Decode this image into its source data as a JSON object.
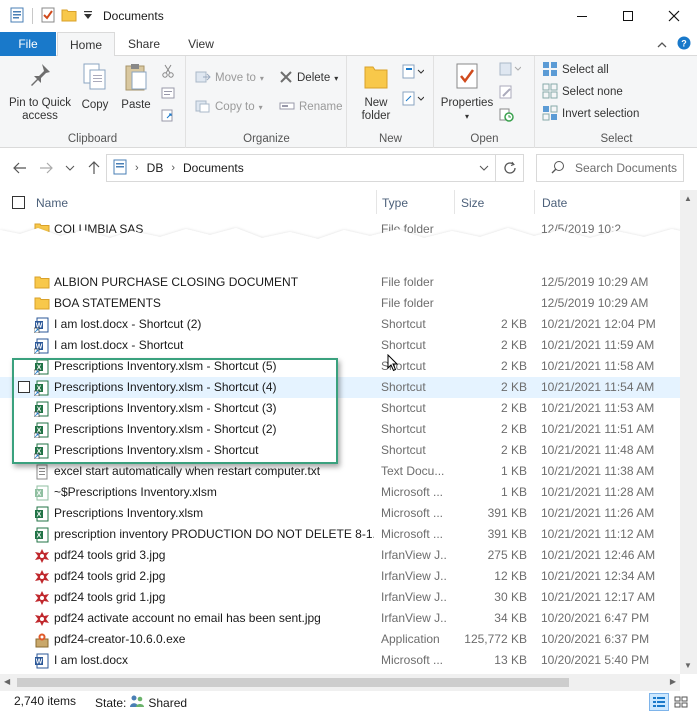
{
  "window": {
    "title": "Documents",
    "icons": [
      "properties-icon",
      "check-icon",
      "folder-icon",
      "dropdown-icon"
    ]
  },
  "ribbon_tabs": {
    "file": "File",
    "home": "Home",
    "share": "Share",
    "view": "View"
  },
  "ribbon": {
    "clipboard": {
      "label": "Clipboard",
      "pin": "Pin to Quick access",
      "pin_l1": "Pin to Quick",
      "pin_l2": "access",
      "copy": "Copy",
      "paste": "Paste"
    },
    "organize": {
      "label": "Organize",
      "move_to": "Move to",
      "copy_to": "Copy to",
      "delete": "Delete",
      "rename": "Rename"
    },
    "new": {
      "label": "New",
      "new_folder_l1": "New",
      "new_folder_l2": "folder"
    },
    "open": {
      "label": "Open",
      "properties": "Properties"
    },
    "select": {
      "label": "Select",
      "select_all": "Select all",
      "select_none": "Select none",
      "invert": "Invert selection"
    }
  },
  "address": {
    "crumbs": [
      "DB",
      "Documents"
    ],
    "search_placeholder": "Search Documents"
  },
  "columns": {
    "name": "Name",
    "type": "Type",
    "size": "Size",
    "date": "Date"
  },
  "partial_rows": {
    "top_name": "COLUMBIA SAS",
    "top_type": "File folder",
    "top_date": "12/5/2019 10:2",
    "second_name": "ALBION PURCHASE CLOSING DOCUMENT",
    "second_type": "File folder",
    "second_date": "12/5/2019 10:29 AM"
  },
  "files": [
    {
      "name": "BOA STATEMENTS",
      "type": "File folder",
      "size": "",
      "date": "12/5/2019 10:29 AM",
      "icon": "folder-icon"
    },
    {
      "name": "I am lost.docx - Shortcut (2)",
      "type": "Shortcut",
      "size": "2 KB",
      "date": "10/21/2021 12:04 PM",
      "icon": "word-shortcut-icon"
    },
    {
      "name": "I am lost.docx - Shortcut",
      "type": "Shortcut",
      "size": "2 KB",
      "date": "10/21/2021 11:59 AM",
      "icon": "word-shortcut-icon"
    },
    {
      "name": "Prescriptions Inventory.xlsm - Shortcut (5)",
      "type": "Shortcut",
      "size": "2 KB",
      "date": "10/21/2021 11:58 AM",
      "icon": "excel-shortcut-icon"
    },
    {
      "name": "Prescriptions Inventory.xlsm - Shortcut (4)",
      "type": "Shortcut",
      "size": "2 KB",
      "date": "10/21/2021 11:54 AM",
      "icon": "excel-shortcut-icon"
    },
    {
      "name": "Prescriptions Inventory.xlsm - Shortcut (3)",
      "type": "Shortcut",
      "size": "2 KB",
      "date": "10/21/2021 11:53 AM",
      "icon": "excel-shortcut-icon"
    },
    {
      "name": "Prescriptions Inventory.xlsm - Shortcut (2)",
      "type": "Shortcut",
      "size": "2 KB",
      "date": "10/21/2021 11:51 AM",
      "icon": "excel-shortcut-icon"
    },
    {
      "name": "Prescriptions Inventory.xlsm - Shortcut",
      "type": "Shortcut",
      "size": "2 KB",
      "date": "10/21/2021 11:48 AM",
      "icon": "excel-shortcut-icon"
    },
    {
      "name": "excel start automatically when restart computer.txt",
      "type": "Text Docu...",
      "size": "1 KB",
      "date": "10/21/2021 11:38 AM",
      "icon": "text-file-icon"
    },
    {
      "name": "~$Prescriptions Inventory.xlsm",
      "type": "Microsoft ...",
      "size": "1 KB",
      "date": "10/21/2021 11:28 AM",
      "icon": "excel-temp-icon"
    },
    {
      "name": "Prescriptions Inventory.xlsm",
      "type": "Microsoft ...",
      "size": "391 KB",
      "date": "10/21/2021 11:26 AM",
      "icon": "excel-icon"
    },
    {
      "name": "prescription inventory PRODUCTION DO NOT DELETE 8-1...",
      "type": "Microsoft ...",
      "size": "391 KB",
      "date": "10/21/2021 11:12 AM",
      "icon": "excel-icon"
    },
    {
      "name": "pdf24 tools grid 3.jpg",
      "type": "IrfanView J...",
      "size": "275 KB",
      "date": "10/21/2021 12:46 AM",
      "icon": "irfanview-icon"
    },
    {
      "name": "pdf24 tools grid 2.jpg",
      "type": "IrfanView J...",
      "size": "12 KB",
      "date": "10/21/2021 12:34 AM",
      "icon": "irfanview-icon"
    },
    {
      "name": "pdf24 tools grid 1.jpg",
      "type": "IrfanView J...",
      "size": "30 KB",
      "date": "10/21/2021 12:17 AM",
      "icon": "irfanview-icon"
    },
    {
      "name": "pdf24 activate account no email has been sent.jpg",
      "type": "IrfanView J...",
      "size": "34 KB",
      "date": "10/20/2021 6:47 PM",
      "icon": "irfanview-icon"
    },
    {
      "name": "pdf24-creator-10.6.0.exe",
      "type": "Application",
      "size": "125,772 KB",
      "date": "10/20/2021 6:37 PM",
      "icon": "installer-icon"
    },
    {
      "name": "I am lost.docx",
      "type": "Microsoft ...",
      "size": "13 KB",
      "date": "10/20/2021 5:40 PM",
      "icon": "word-icon"
    }
  ],
  "status": {
    "count": "2,740 items",
    "state_label": "State:",
    "state_value": "Shared"
  },
  "colors": {
    "accent": "#1979ca",
    "highlight_box": "#3aa17e",
    "hover_row": "#e5f3ff"
  }
}
